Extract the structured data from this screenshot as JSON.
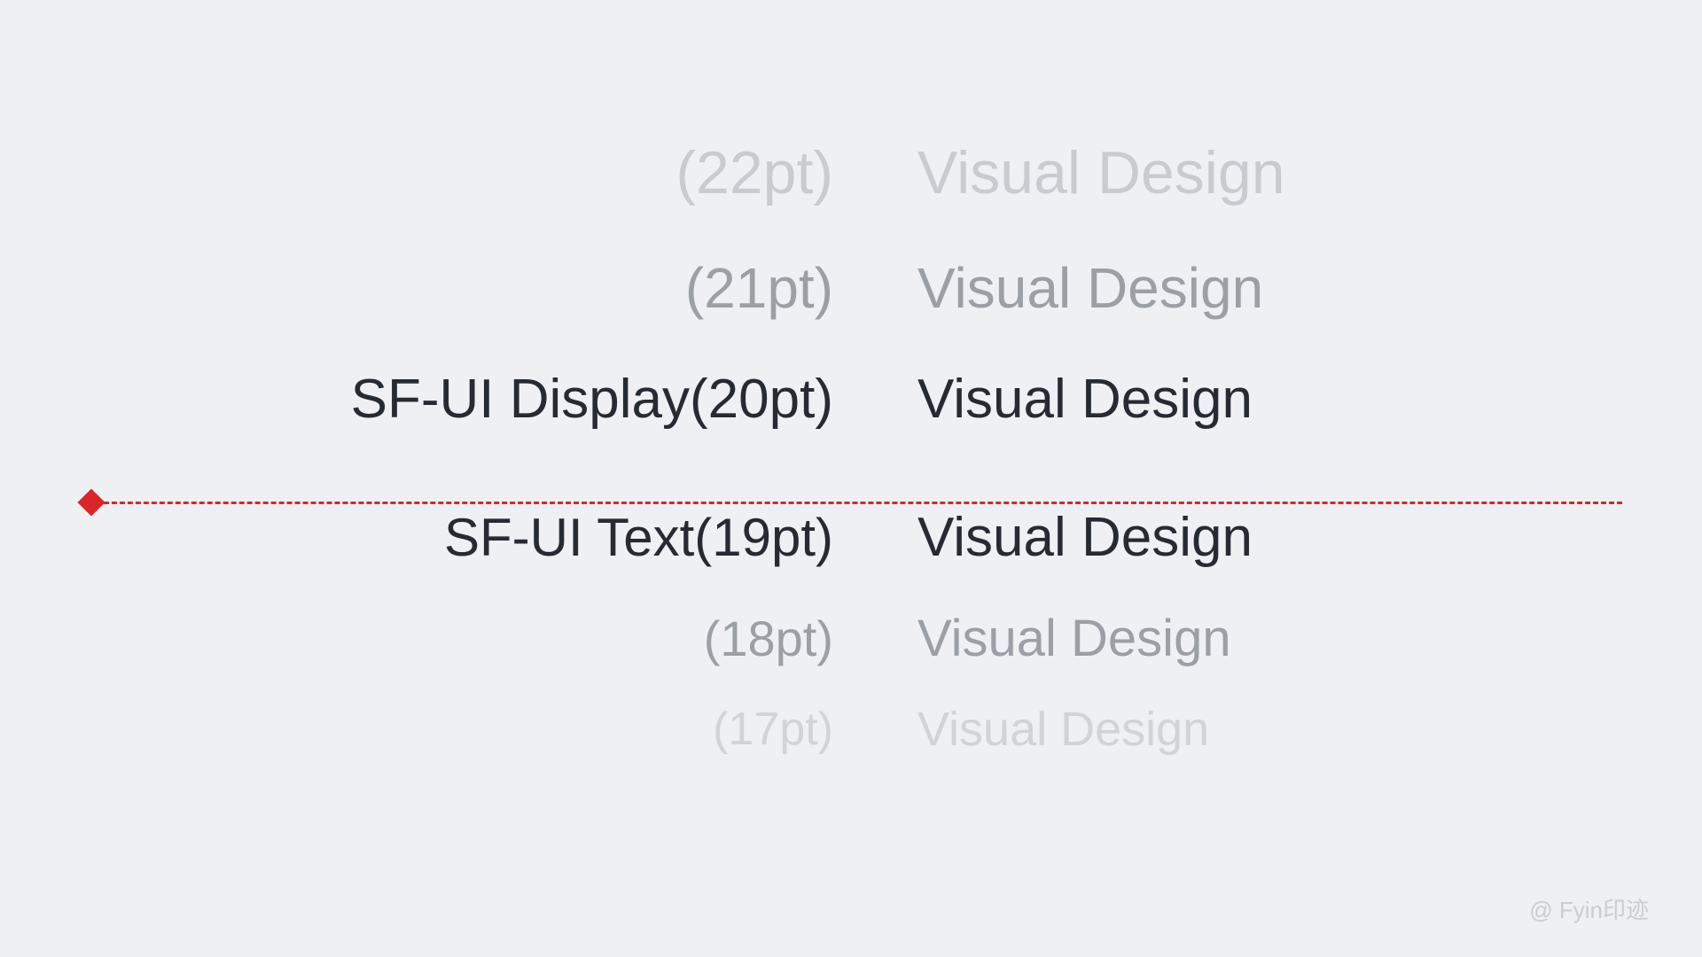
{
  "rows": [
    {
      "label": "(22pt)",
      "sample": "Visual Design"
    },
    {
      "label": "(21pt)",
      "sample": "Visual Design"
    },
    {
      "label": "SF-UI Display(20pt)",
      "sample": "Visual Design"
    },
    {
      "label": "SF-UI Text(19pt)",
      "sample": "Visual Design"
    },
    {
      "label": "(18pt)",
      "sample": "Visual Design"
    },
    {
      "label": "(17pt)",
      "sample": "Visual Design"
    }
  ],
  "watermark": "@ Fyin印迹",
  "divider_color": "#d9262b"
}
